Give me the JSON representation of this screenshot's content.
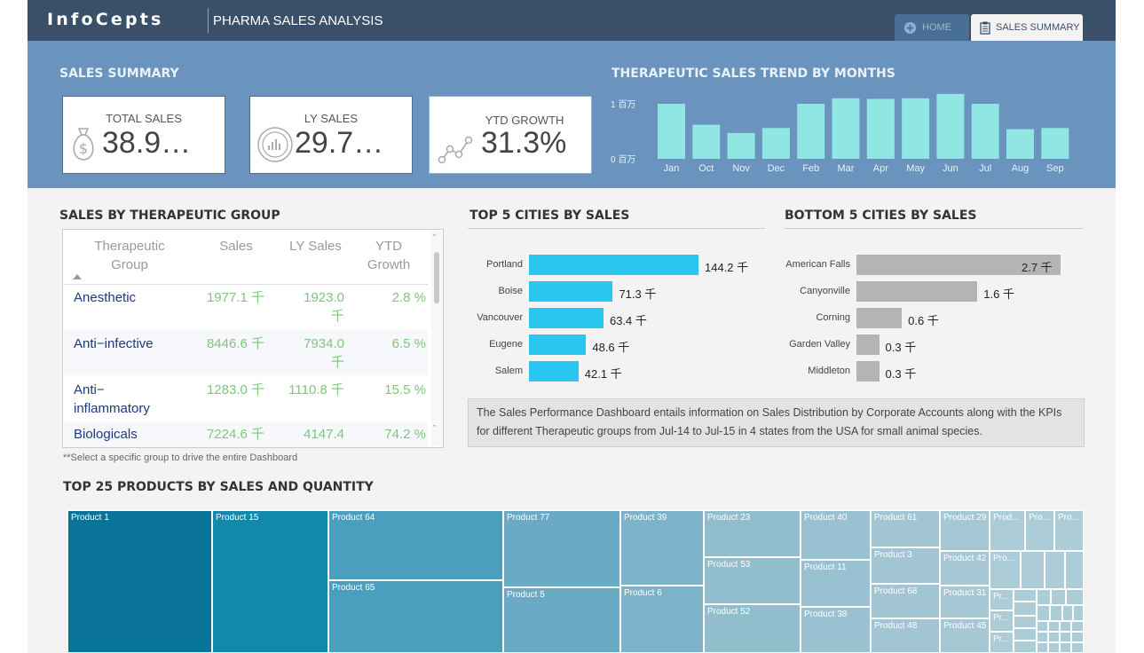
{
  "header": {
    "logo": "InfoCepts",
    "title": "PHARMA SALES ANALYSIS",
    "tabs": [
      {
        "label": "HOME",
        "icon": "plus-circle-icon",
        "active": false
      },
      {
        "label": "SALES SUMMARY",
        "icon": "clipboard-icon",
        "active": true
      }
    ]
  },
  "sales_summary": {
    "title": "SALES SUMMARY",
    "kpis": [
      {
        "label": "TOTAL SALES",
        "value": "38.9…",
        "icon": "money-bag-icon"
      },
      {
        "label": "LY SALES",
        "value": "29.7…",
        "icon": "chart-coin-icon"
      },
      {
        "label": "YTD GROWTH",
        "value": "31.3%",
        "icon": "trend-line-icon"
      }
    ]
  },
  "trend": {
    "title": "THERAPEUTIC SALES TREND BY MONTHS",
    "ytick_top": "1 百万",
    "ytick_bottom": "0 百万"
  },
  "chart_data": [
    {
      "type": "bar",
      "title": "THERAPEUTIC SALES TREND BY MONTHS",
      "categories": [
        "Jan",
        "Oct",
        "Nov",
        "Dec",
        "Feb",
        "Mar",
        "Apr",
        "May",
        "Jun",
        "Jul",
        "Aug",
        "Sep"
      ],
      "values": [
        1.0,
        0.62,
        0.47,
        0.56,
        1.0,
        1.1,
        1.09,
        1.1,
        1.18,
        1.0,
        0.54,
        0.56
      ],
      "yticks": [
        "0 百万",
        "1 百万"
      ],
      "colors": [
        "#8fe6e3"
      ]
    },
    {
      "type": "bar",
      "orientation": "horizontal",
      "title": "TOP 5 CITIES BY SALES",
      "categories": [
        "Portland",
        "Boise",
        "Vancouver",
        "Eugene",
        "Salem"
      ],
      "values": [
        144.2,
        71.3,
        63.4,
        48.6,
        42.1
      ],
      "labels": [
        "144.2 千",
        "71.3 千",
        "63.4 千",
        "48.6 千",
        "42.1 千"
      ],
      "colors": [
        "#29c7ef"
      ]
    },
    {
      "type": "bar",
      "orientation": "horizontal",
      "title": "BOTTOM 5 CITIES BY SALES",
      "categories": [
        "American Falls",
        "Canyonville",
        "Corning",
        "Garden Valley",
        "Middleton"
      ],
      "values": [
        2.7,
        1.6,
        0.6,
        0.3,
        0.3
      ],
      "labels": [
        "2.7 千",
        "1.6 千",
        "0.6 千",
        "0.3 千",
        "0.3 千"
      ],
      "colors": [
        "#b4b4b4"
      ]
    },
    {
      "type": "table",
      "title": "SALES BY THERAPEUTIC GROUP",
      "columns": [
        "Therapeutic Group",
        "Sales",
        "LY Sales",
        "YTD Growth"
      ],
      "rows": [
        [
          "Anesthetic",
          "1977.1 千",
          "1923.0 千",
          "2.8 %"
        ],
        [
          "Anti−infective",
          "8446.6 千",
          "7934.0 千",
          "6.5 %"
        ],
        [
          "Anti− inflammatory",
          "1283.0 千",
          "1110.8 千",
          "15.5 %"
        ],
        [
          "Biologicals",
          "7224.6 千",
          "4147.4",
          "74.2 %"
        ]
      ]
    }
  ],
  "therapeutic": {
    "title": "SALES BY THERAPEUTIC GROUP",
    "headers": {
      "group_line1": "Therapeutic",
      "group_line2": "Group",
      "sales": "Sales",
      "ly_line1": "LY Sales",
      "ytd_line1": "YTD",
      "ytd_line2": "Growth"
    },
    "rows": [
      {
        "group": "Anesthetic",
        "group2": "",
        "sales": "1977.1 千",
        "ly": "1923.0",
        "ly2": "千",
        "ytd": "2.8 %"
      },
      {
        "group": "Anti−infective",
        "group2": "",
        "sales": "8446.6 千",
        "ly": "7934.0",
        "ly2": "千",
        "ytd": "6.5 %"
      },
      {
        "group": "Anti−",
        "group2": "inflammatory",
        "sales": "1283.0 千",
        "ly": "1110.8 千",
        "ly2": "",
        "ytd": "15.5 %"
      },
      {
        "group": "Biologicals",
        "group2": "",
        "sales": "7224.6 千",
        "ly": "4147.4",
        "ly2": "",
        "ytd": "74.2 %"
      }
    ],
    "note": "**Select a specific group to drive the entire Dashboard"
  },
  "top_cities": {
    "title": "TOP 5 CITIES BY SALES"
  },
  "bottom_cities": {
    "title": "BOTTOM 5 CITIES BY SALES"
  },
  "description": "The Sales Performance Dashboard entails information on Sales Distribution by Corporate Accounts along with the KPIs for different Therapeutic groups from Jul-14 to Jul-15 in 4 states from the USA for small animal species.",
  "treemap": {
    "title": "TOP 25 PRODUCTS BY SALES AND QUANTITY",
    "labels": [
      "Product 1",
      "Product 15",
      "Product 64",
      "Product 65",
      "Product 77",
      "Product 5",
      "Product 39",
      "Product 6",
      "Product 23",
      "Product 53",
      "Product 52",
      "Product 40",
      "Product 11",
      "Product 38",
      "Product 61",
      "Product 3",
      "Product 68",
      "Product 48",
      "Product 29",
      "Product 42",
      "Product 31",
      "Product 45",
      "Prod...",
      "Pro...",
      "Pro...",
      "Pro...",
      "Pr...",
      "Pr...",
      "Pr...",
      "Pr..."
    ]
  }
}
